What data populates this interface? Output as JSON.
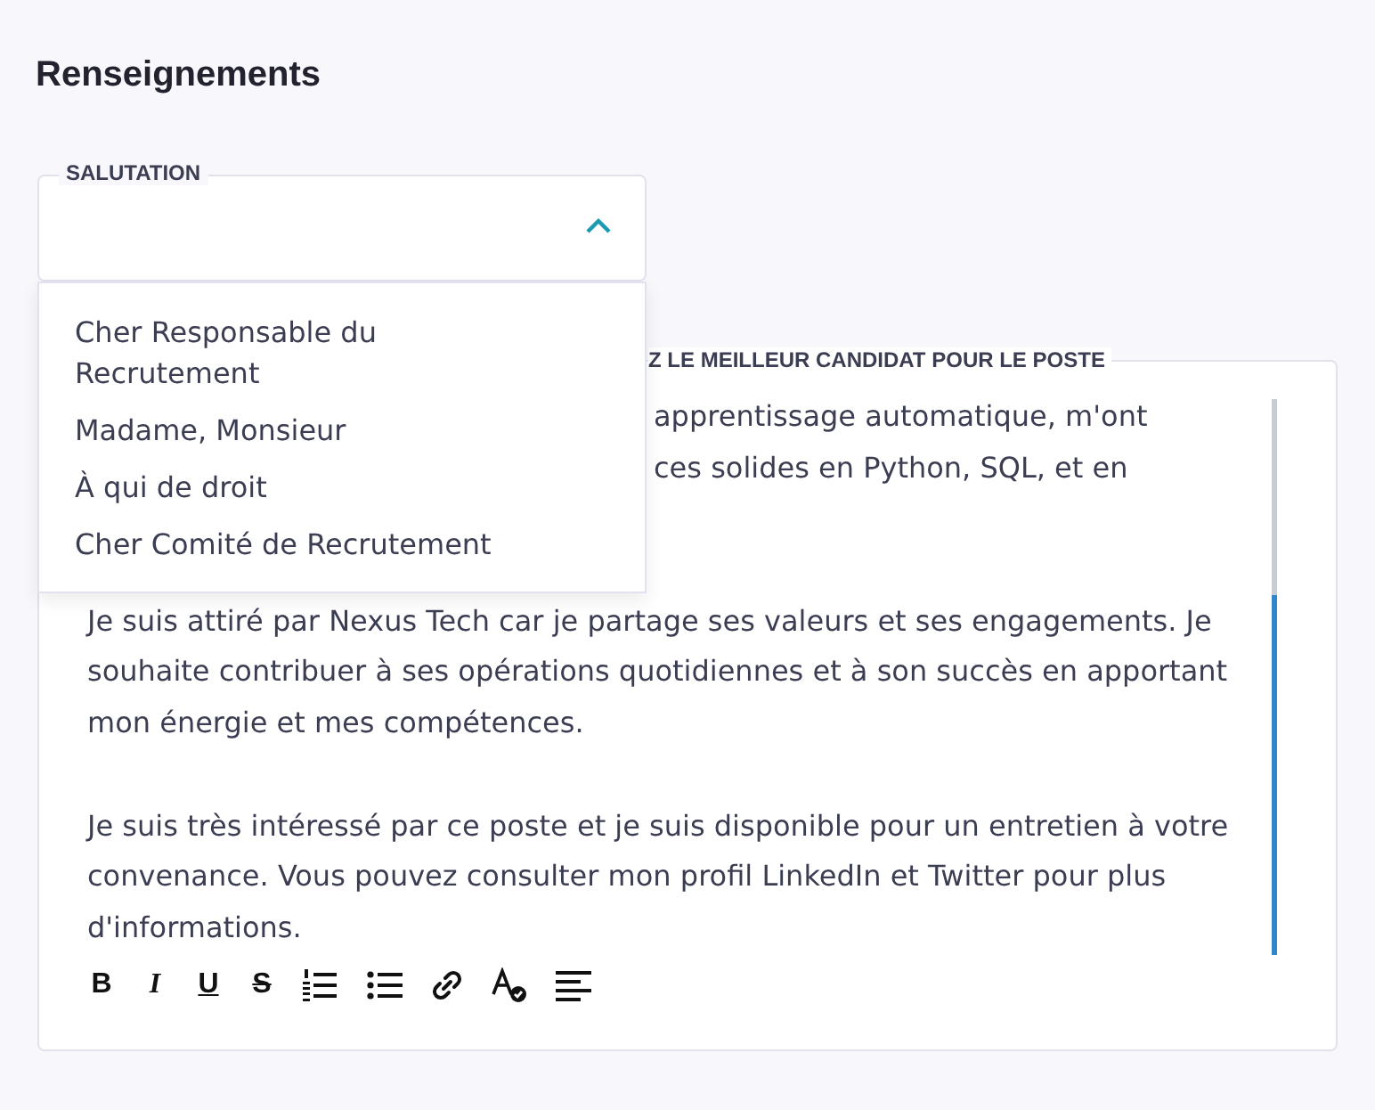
{
  "section_title": "Renseignements",
  "salutation": {
    "label": "SALUTATION",
    "expanded": true,
    "options": [
      {
        "label": "Cher Responsable du Recrutement",
        "selected": false
      },
      {
        "label": "Madame, Monsieur",
        "selected": false
      },
      {
        "label": "À qui de droit",
        "selected": false
      },
      {
        "label": "Cher Comité de Recrutement",
        "selected": false
      }
    ]
  },
  "letter": {
    "label": "Z LE MEILLEUR CANDIDAT POUR LE POSTE",
    "partial_lines": [
      "apprentissage automatique, m'ont",
      "ces solides en Python, SQL, et en"
    ],
    "paragraphs": [
      "Je suis attiré par Nexus Tech car je partage ses valeurs et ses engagements. Je souhaite contribuer à ses opérations quotidiennes et à son succès en apportant mon énergie et mes compétences.",
      "Je suis très intéressé par ce poste et je suis disponible pour un entretien à votre convenance. Vous pouvez consulter mon profil LinkedIn et Twitter pour plus d'informations."
    ],
    "toolbar": [
      {
        "kind": "bold",
        "label": "B"
      },
      {
        "kind": "italic",
        "label": "I"
      },
      {
        "kind": "underline",
        "label": "U"
      },
      {
        "kind": "strike",
        "label": "S"
      },
      {
        "kind": "ordered-list"
      },
      {
        "kind": "bullet-list"
      },
      {
        "kind": "link"
      },
      {
        "kind": "spellcheck"
      },
      {
        "kind": "align"
      }
    ]
  }
}
